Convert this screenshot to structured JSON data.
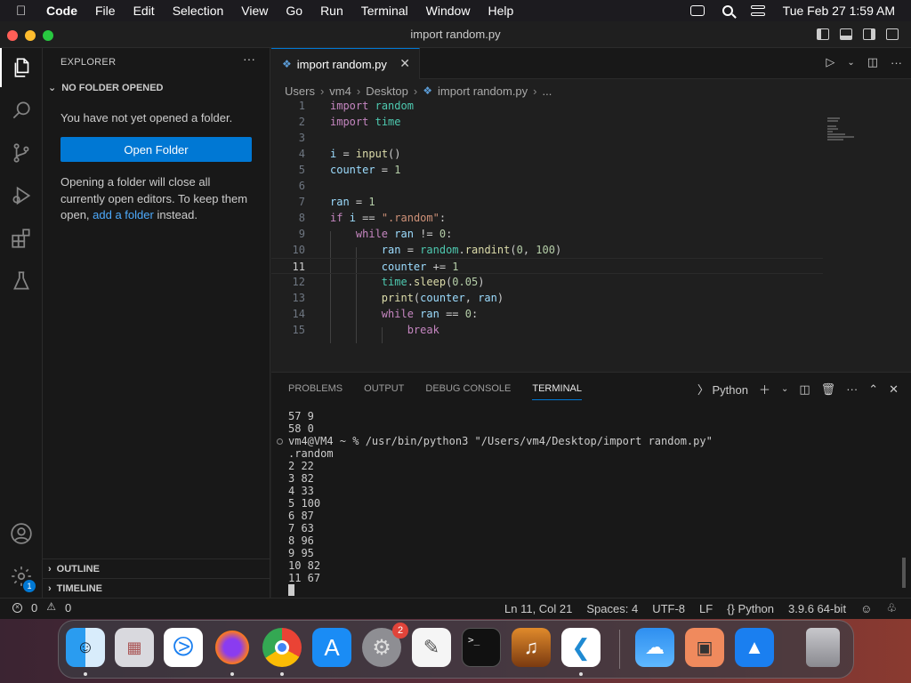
{
  "menubar": {
    "app_name": "Code",
    "menus": [
      "File",
      "Edit",
      "Selection",
      "View",
      "Go",
      "Run",
      "Terminal",
      "Window",
      "Help"
    ],
    "datetime": "Tue Feb 27  1:59 AM"
  },
  "window": {
    "title": "import random.py",
    "traffic_light_colors": [
      "#ff5f57",
      "#febc2e",
      "#28c840"
    ]
  },
  "activity_bar": {
    "items": [
      "files-icon",
      "search-icon",
      "source-control-icon",
      "run-debug-icon",
      "extensions-icon",
      "testing-icon"
    ],
    "bottom": [
      "account-icon",
      "manage-gear-icon"
    ],
    "manage_badge": "1"
  },
  "sidebar": {
    "title": "EXPLORER",
    "more": "···",
    "section": "NO FOLDER OPENED",
    "message": "You have not yet opened a folder.",
    "open_button": "Open Folder",
    "paragraph_start": "Opening a folder will close all currently open editors. To keep them open, ",
    "link": "add a folder",
    "paragraph_end": " instead.",
    "outline": "OUTLINE",
    "timeline": "TIMELINE"
  },
  "editor": {
    "tab_label": "import random.py",
    "breadcrumb": [
      "Users",
      "vm4",
      "Desktop",
      "import random.py",
      "..."
    ],
    "current_line": 11
  },
  "panel": {
    "tabs": [
      "PROBLEMS",
      "OUTPUT",
      "DEBUG CONSOLE",
      "TERMINAL"
    ],
    "active_tab": "TERMINAL",
    "terminal_profile": "Python",
    "terminal_lines": [
      "57 9",
      "58 0",
      "vm4@VM4 ~ % /usr/bin/python3 \"/Users/vm4/Desktop/import random.py\"",
      ".random",
      "2 22",
      "3 82",
      "4 33",
      "5 100",
      "6 87",
      "7 63",
      "8 96",
      "9 95",
      "10 82",
      "11 67"
    ]
  },
  "statusbar": {
    "errors": "0",
    "warnings": "0",
    "position": "Ln 11, Col 21",
    "spaces": "Spaces: 4",
    "encoding": "UTF-8",
    "eol": "LF",
    "language": "Python",
    "interpreter": "3.9.6 64-bit"
  },
  "dock": {
    "apps": [
      "finder-icon",
      "launchpad-icon",
      "safari-icon",
      "firefox-icon",
      "chrome-icon",
      "app-store-icon",
      "system-settings-icon",
      "textedit-icon",
      "terminal-icon",
      "garageband-icon",
      "vscode-icon",
      "weather-icon",
      "remote-desktop-icon",
      "keynote-icon",
      "trash-icon"
    ],
    "settings_badge": "2"
  }
}
